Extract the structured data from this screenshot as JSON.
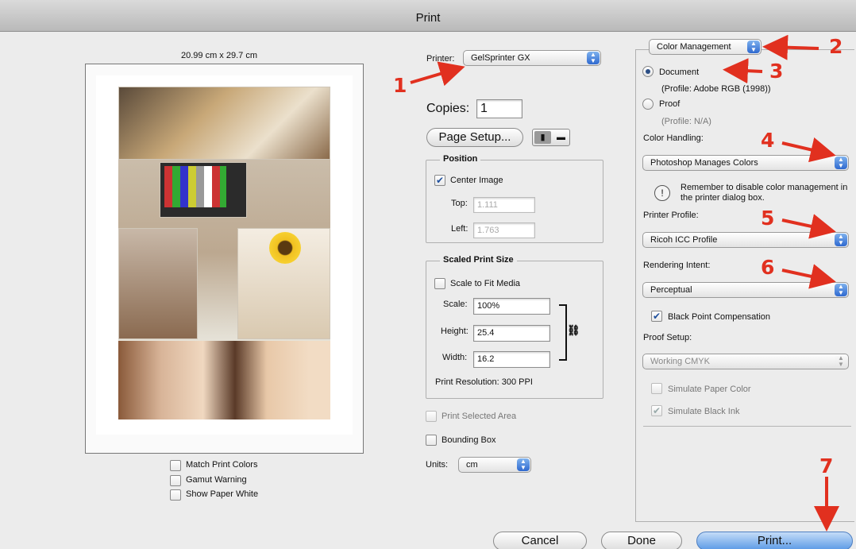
{
  "window": {
    "title": "Print"
  },
  "preview": {
    "paper_size": "20.99 cm x 29.7 cm",
    "options": [
      {
        "label": "Match Print Colors",
        "checked": false
      },
      {
        "label": "Gamut Warning",
        "checked": false
      },
      {
        "label": "Show Paper White",
        "checked": false
      }
    ]
  },
  "printer": {
    "label": "Printer:",
    "value": "GelSprinter GX"
  },
  "copies": {
    "label": "Copies:",
    "value": "1"
  },
  "page_setup": {
    "label": "Page Setup..."
  },
  "position": {
    "title": "Position",
    "center_image": {
      "label": "Center Image",
      "checked": true
    },
    "top": {
      "label": "Top:",
      "value": "1.111"
    },
    "left": {
      "label": "Left:",
      "value": "1.763"
    }
  },
  "scaled": {
    "title": "Scaled Print Size",
    "scale_to_fit": {
      "label": "Scale to Fit Media",
      "checked": false
    },
    "scale": {
      "label": "Scale:",
      "value": "100%"
    },
    "height": {
      "label": "Height:",
      "value": "25.4"
    },
    "width": {
      "label": "Width:",
      "value": "16.2"
    },
    "resolution": "Print Resolution: 300 PPI"
  },
  "print_selected_area": {
    "label": "Print Selected Area",
    "checked": false
  },
  "bounding_box": {
    "label": "Bounding Box",
    "checked": false
  },
  "units": {
    "label": "Units:",
    "value": "cm"
  },
  "color_management": {
    "section": "Color Management",
    "document": {
      "label": "Document",
      "profile": "(Profile: Adobe RGB (1998))",
      "selected": true
    },
    "proof": {
      "label": "Proof",
      "profile": "(Profile: N/A)",
      "selected": false
    },
    "color_handling": {
      "label": "Color Handling:",
      "value": "Photoshop Manages Colors"
    },
    "reminder": "Remember to disable color management in the printer dialog box.",
    "printer_profile": {
      "label": "Printer Profile:",
      "value": "Ricoh ICC Profile"
    },
    "rendering_intent": {
      "label": "Rendering Intent:",
      "value": "Perceptual"
    },
    "black_point": {
      "label": "Black Point Compensation",
      "checked": true
    },
    "proof_setup": {
      "label": "Proof Setup:",
      "value": "Working CMYK"
    },
    "simulate_paper": {
      "label": "Simulate Paper Color",
      "checked": false
    },
    "simulate_ink": {
      "label": "Simulate Black Ink",
      "checked": true
    }
  },
  "buttons": {
    "cancel": "Cancel",
    "done": "Done",
    "print": "Print..."
  },
  "annotations": [
    "1",
    "2",
    "3",
    "4",
    "5",
    "6",
    "7"
  ],
  "colors": {
    "annotation": "#e1301f",
    "accent": "#2f69cf"
  },
  "icons": [
    "up-down-arrows-icon",
    "portrait-orientation-icon",
    "landscape-orientation-icon",
    "link-chain-icon",
    "info-icon"
  ]
}
